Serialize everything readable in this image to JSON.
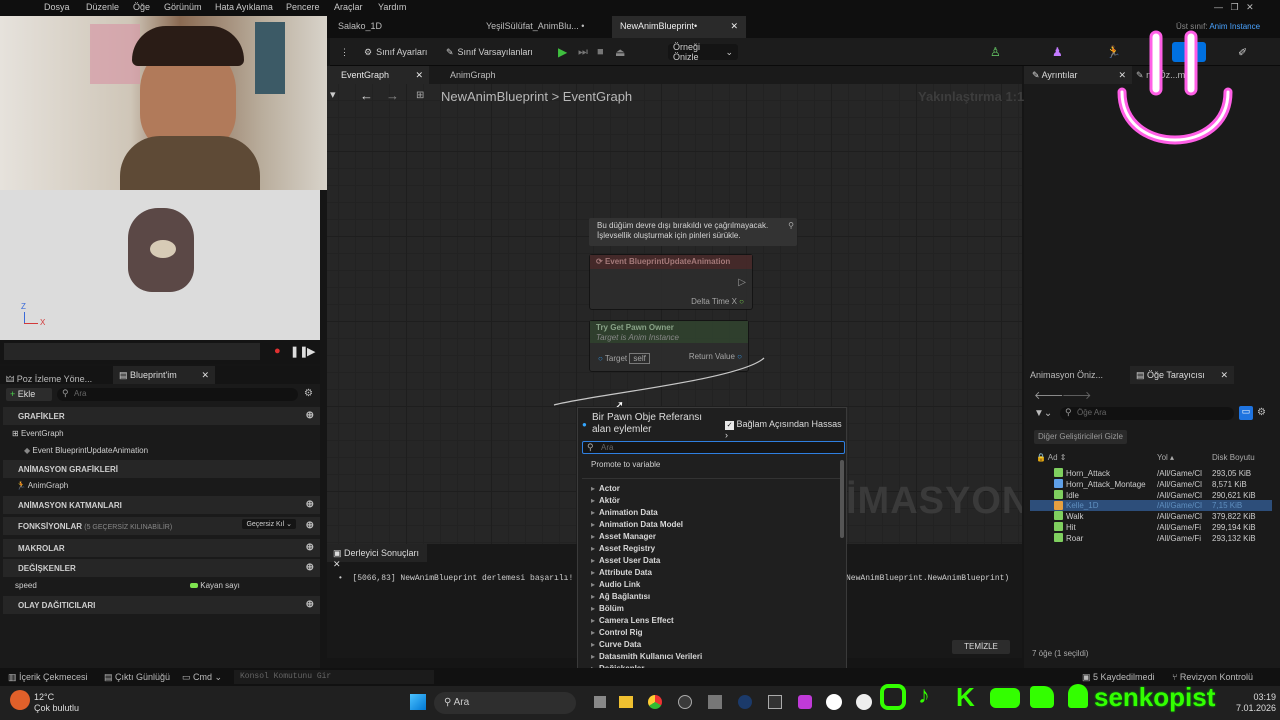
{
  "menu": [
    "Dosya",
    "Düzenle",
    "Öğe",
    "Görünüm",
    "Hata Ayıklama",
    "Pencere",
    "Araçlar",
    "Yardım"
  ],
  "doc_tabs": [
    {
      "label": "Salako_1D"
    },
    {
      "label": "YeşilSülüfat_AnimBlu...",
      "mark": "•"
    },
    {
      "label": "NewAnimBlueprint•",
      "close": "✕"
    }
  ],
  "parent_class": {
    "label": "Üst sınıf:",
    "value": "Anim Instance"
  },
  "toolbar": {
    "class_settings": "Sınıf Ayarları",
    "class_defaults": "Sınıf Varsayılanları",
    "preview": "Örneği Önizle"
  },
  "graph_tabs": [
    "EventGraph",
    "AnimGraph"
  ],
  "breadcrumb": {
    "root": "NewAnimBlueprint",
    "sep": ">",
    "current": "EventGraph"
  },
  "zoom": "Yakınlaştırma 1:1",
  "watermark": "İMASYON",
  "details": {
    "tab": "Ayrıntılar",
    "tab2": "ne Öz...me..."
  },
  "nodes": {
    "tooltip_line1": "Bu düğüm devre dışı bırakıldı ve çağrılmayacak.",
    "tooltip_line2": "İşlevsellik oluşturmak için pinleri sürükle.",
    "event": "Event BlueprintUpdateAnimation",
    "delta": "Delta Time X",
    "try_get": "Try Get Pawn Owner",
    "target_is": "Target is Anim Instance",
    "target": "Target",
    "self": "self",
    "return": "Return Value"
  },
  "popup": {
    "title_line1": "Bir Pawn Obje Referansı",
    "title_line2": "alan eylemler",
    "context": "Bağlam Açısından Hassas",
    "search_placeholder": "Ara",
    "promote": "Promote to variable",
    "categories": [
      "Actor",
      "Aktör",
      "Animation Data",
      "Animation Data Model",
      "Asset Manager",
      "Asset Registry",
      "Asset User Data",
      "Attribute Data",
      "Audio Link",
      "Ağ Bağlantısı",
      "Bölüm",
      "Camera Lens Effect",
      "Control Rig",
      "Curve Data",
      "Datasmith Kullanıcı Verileri",
      "Değişkenler"
    ]
  },
  "viewport": {
    "axis_z": "Z",
    "axis_x": "X"
  },
  "left_tabs": [
    "Poz İzleme Yöne...",
    "Blueprint'im"
  ],
  "myblueprint": {
    "add": "Ekle",
    "search_placeholder": "Ara",
    "graphs": "GRAFİKLER",
    "event_graph": "EventGraph",
    "event_item": "Event BlueprintUpdateAnimation",
    "anim_graphs": "ANİMASYON GRAFİKLERİ",
    "anim_graph": "AnimGraph",
    "anim_layers": "ANİMASYON KATMANLARI",
    "functions": "FONKSİYONLAR",
    "functions_note": "(5 GEÇERSİZ KILINABİLİR)",
    "override": "Geçersiz Kıl",
    "macros": "MAKROLAR",
    "variables": "DEĞİŞKENLER",
    "var_name": "speed",
    "var_type": "Kayan sayı",
    "dispatchers": "OLAY DAĞITICILARI"
  },
  "compiler": {
    "tab": "Derleyici Sonuçları",
    "line": "[5066,83] NewAnimBlueprint derlemesi başarılı! [8",
    "line_end": "NewAnimBlueprint.NewAnimBlueprint)",
    "clear": "TEMİZLE"
  },
  "content_browser": {
    "tab1": "Animasyon Öniz...",
    "tab2": "Öğe Tarayıcısı",
    "search": "Öğe Ara",
    "dev_content": "Diğer Geliştiricileri Gizle",
    "col_name": "Ad",
    "col_path": "Yol",
    "col_size": "Disk Boyutu",
    "rows": [
      {
        "name": "Horn_Attack",
        "path": "/All/Game/Cl",
        "size": "293,05 KiB"
      },
      {
        "name": "Horn_Attack_Montage",
        "path": "/All/Game/Cl",
        "size": "8,571 KiB"
      },
      {
        "name": "Idle",
        "path": "/All/Game/Cl",
        "size": "290,621 KiB"
      },
      {
        "name": "Kelle_1D",
        "path": "/All/Game/Cl",
        "size": "7,15 KiB"
      },
      {
        "name": "Walk",
        "path": "/All/Game/Cl",
        "size": "379,822 KiB"
      },
      {
        "name": "Hit",
        "path": "/All/Game/Fi",
        "size": "299,194 KiB"
      },
      {
        "name": "Roar",
        "path": "/All/Game/Fi",
        "size": "293,132 KiB"
      }
    ],
    "status": "7 öğe (1 seçildi)"
  },
  "statusbar": {
    "drawer": "İçerik Çekmecesi",
    "log": "Çıktı Günlüğü",
    "cmd": "Cmd",
    "console": "Konsol Komutunu Gir",
    "saved": "5 Kaydedilmedi",
    "revision": "Revizyon Kontrolü"
  },
  "taskbar": {
    "temp": "12°C",
    "weather": "Çok bulutlu",
    "search": "Ara",
    "time": "03:19",
    "date": "7.01.2026",
    "brand": "senkopist"
  },
  "colors": {
    "accent": "#0070e0",
    "exec": "#ffffff",
    "float": "#7ee34f",
    "object": "#34a6ff",
    "brand": "#33ff00",
    "neon": "#ff5fe6"
  }
}
